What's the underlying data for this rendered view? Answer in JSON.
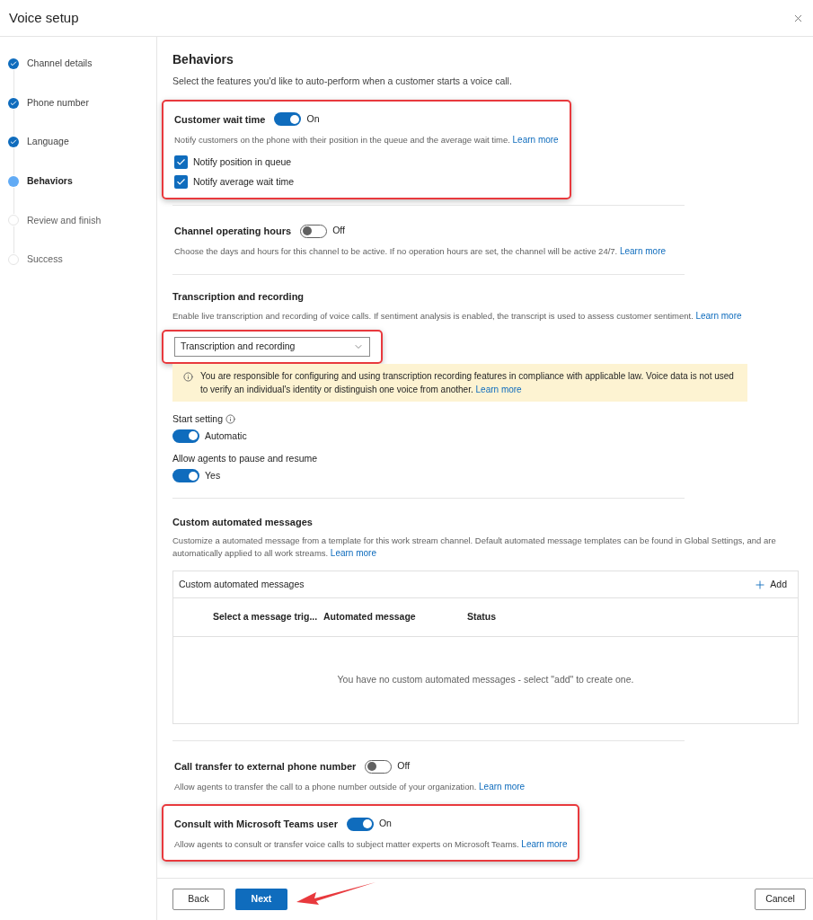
{
  "window": {
    "title": "Voice setup"
  },
  "steps": [
    {
      "label": "Channel details",
      "completed": true,
      "selected": false
    },
    {
      "label": "Phone number",
      "completed": true,
      "selected": false
    },
    {
      "label": "Language",
      "completed": true,
      "selected": false
    },
    {
      "label": "Behaviors",
      "completed": false,
      "selected": true
    },
    {
      "label": "Review and finish",
      "completed": false,
      "selected": false
    },
    {
      "label": "Success",
      "completed": false,
      "selected": false
    }
  ],
  "page": {
    "title": "Behaviors",
    "subtitle": "Select the features you'd like to auto-perform when a customer starts a voice call."
  },
  "sections": [
    {
      "kind": "toggle",
      "title": "Customer wait time",
      "on": true,
      "state_label": "On",
      "description": "Notify customers on the phone with their position in the queue and the average wait time.",
      "link": "Learn more",
      "highlighted": true,
      "divider_after": true,
      "options": [
        {
          "label": "Notify position in queue",
          "checked": true
        },
        {
          "label": "Notify average wait time",
          "checked": true
        }
      ]
    },
    {
      "kind": "toggle",
      "title": "Channel operating hours",
      "on": false,
      "state_label": "Off",
      "description": "Choose the days and hours for this channel to be active. If no operation hours are set, the channel will be active 24/7.",
      "link": "Learn more",
      "highlighted": false,
      "divider_after": true
    },
    {
      "kind": "transcription",
      "title": "Transcription and recording",
      "description": "Enable live transcription and recording of voice calls. If sentiment analysis is enabled, the transcript is used to assess customer sentiment.",
      "link": "Learn more",
      "divider_after": true,
      "dropdown": {
        "value": "Transcription and recording",
        "highlighted": true
      },
      "notice": {
        "text": "You are responsible for configuring and using transcription recording features in compliance with applicable law. Voice data is not used to verify an individual's identity or distinguish one voice from another.",
        "link": "Learn more"
      },
      "settings": [
        {
          "label": "Start setting",
          "info": true,
          "on": true,
          "state_label": "Automatic"
        },
        {
          "label": "Allow agents to pause and resume",
          "info": false,
          "on": true,
          "state_label": "Yes"
        }
      ]
    },
    {
      "kind": "messages",
      "title": "Custom automated messages",
      "description": "Customize a automated message from a template for this work stream channel. Default automated message templates can be found in Global Settings, and are automatically applied to all work streams.",
      "link": "Learn more",
      "divider_after": true,
      "table": {
        "title": "Custom automated messages",
        "add": "Add",
        "columns": [
          "Select a message trig...",
          "Automated message",
          "Status"
        ],
        "empty": "You have no custom automated messages - select \"add\" to create one."
      }
    },
    {
      "kind": "toggle",
      "title": "Call transfer to external phone number",
      "on": false,
      "state_label": "Off",
      "description": "Allow agents to transfer the call to a phone number outside of your organization.",
      "link": "Learn more",
      "highlighted": false,
      "divider_after": false
    },
    {
      "kind": "toggle",
      "title": "Consult with Microsoft Teams user",
      "on": true,
      "state_label": "On",
      "description": "Allow agents to consult or transfer voice calls to subject matter experts on Microsoft Teams.",
      "link": "Learn more",
      "highlighted": true,
      "divider_after": false
    }
  ],
  "footer": {
    "back": "Back",
    "next": "Next",
    "cancel": "Cancel",
    "next_pointer": true
  }
}
